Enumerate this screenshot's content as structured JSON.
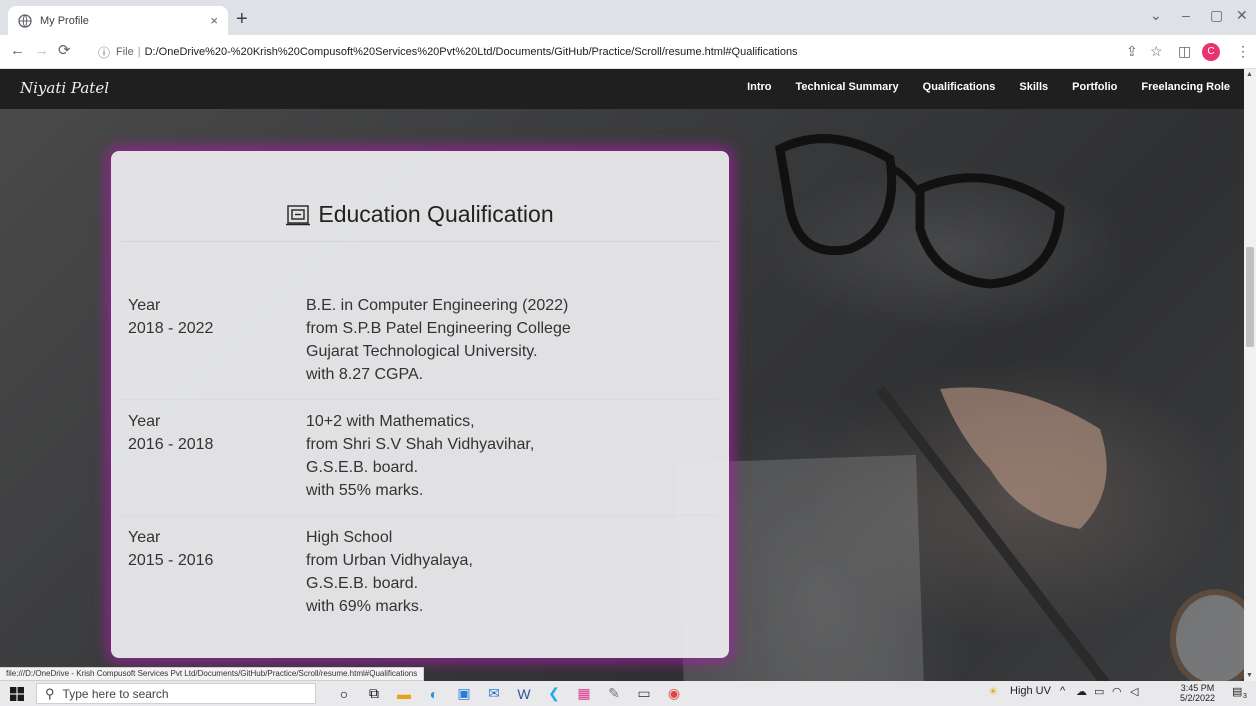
{
  "browser": {
    "tab_title": "My Profile",
    "tab_close": "×",
    "new_tab": "+",
    "window_controls": [
      "⌄",
      "–",
      "▢",
      "✕"
    ],
    "address": {
      "scheme": "File",
      "separator": "|",
      "url": "D:/OneDrive%20-%20Krish%20Compusoft%20Services%20Pvt%20Ltd/Documents/GitHub/Practice/Scroll/resume.html#Qualifications"
    },
    "profile_initial": "C",
    "status_url": "file:///D:/OneDrive - Krish Compusoft Services Pvt Ltd/Documents/GitHub/Practice/Scroll/resume.html#Qualifications"
  },
  "site": {
    "brand": "Niyati Patel",
    "nav": [
      "Intro",
      "Technical Summary",
      "Qualifications",
      "Skills",
      "Portfolio",
      "Freelancing Role"
    ]
  },
  "education": {
    "title": "Education Qualification",
    "rows": [
      {
        "year_label": "Year",
        "years": "2018 - 2022",
        "lines": [
          "B.E. in Computer Engineering (2022)",
          "from S.P.B Patel Engineering College",
          "Gujarat Technological University.",
          "with 8.27 CGPA."
        ]
      },
      {
        "year_label": "Year",
        "years": "2016 - 2018",
        "lines": [
          "10+2 with Mathematics,",
          "from Shri S.V Shah Vidhyavihar,",
          "G.S.E.B. board.",
          "with 55% marks."
        ]
      },
      {
        "year_label": "Year",
        "years": "2015 - 2016",
        "lines": [
          "High School",
          "from Urban Vidhyalaya,",
          "G.S.E.B. board.",
          "with 69% marks."
        ]
      }
    ]
  },
  "taskbar": {
    "search_placeholder": "Type here to search",
    "weather": "High UV",
    "time": "3:45 PM",
    "date": "5/2/2022",
    "notification_count": "3"
  },
  "colors": {
    "card_glow": "#aa1eaa",
    "nav_bg": "#1f1f1f"
  }
}
